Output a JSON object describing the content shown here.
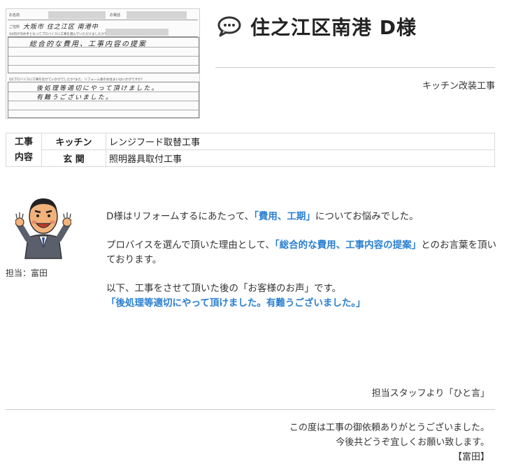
{
  "survey": {
    "name_label": "お名前",
    "phone_label": "お電話",
    "address_label": "ご住所",
    "address_value": "大阪市 住之江区 南港中",
    "q1": "Q4何が決め手となってプロバイスに工事を選んでいただけましたか?",
    "a1": "総合的な費用、工事内容の提案",
    "q2": "Q5プロバイスに工事を任せていかがでしたか?また、リフォーム後のお住まいはいかがですか?",
    "a2_line1": "後処理等適切にやって頂けました。",
    "a2_line2": "有難うございました。"
  },
  "title": "住之江区南港 D様",
  "title_icon": "speech-bubble-icon",
  "work_type": "キッチン改装工事",
  "work_table": {
    "header_line1": "工事",
    "header_line2": "内容",
    "rows": [
      {
        "area": "キッチン",
        "description": "レンジフード取替工事"
      },
      {
        "area": "玄 関",
        "description": "照明器具取付工事"
      }
    ]
  },
  "staff_label": "担当：富田",
  "message": {
    "p1_pre": "D様はリフォームするにあたって、",
    "p1_hl": "「費用、工期」",
    "p1_post": "についてお悩みでした。",
    "p2_pre": "プロバイスを選んで頂いた理由として、",
    "p2_hl": "「総合的な費用、工事内容の提案」",
    "p2_post": "とのお言葉を頂いております。",
    "p3_line1": "以下、工事をさせて頂いた後の「お客様のお声」です。",
    "p3_hl": "「後処理等適切にやって頂けました。有難うございました。」"
  },
  "footer_label": "担当スタッフより「ひと言」",
  "closing": {
    "line1": "この度は工事の御依頼ありがとうございました。",
    "line2": "今後共どうぞ宜しくお願い致します。",
    "signature": "【富田】"
  },
  "colors": {
    "highlight": "#2a7fd0",
    "text": "#333333",
    "rule": "#cccccc"
  }
}
